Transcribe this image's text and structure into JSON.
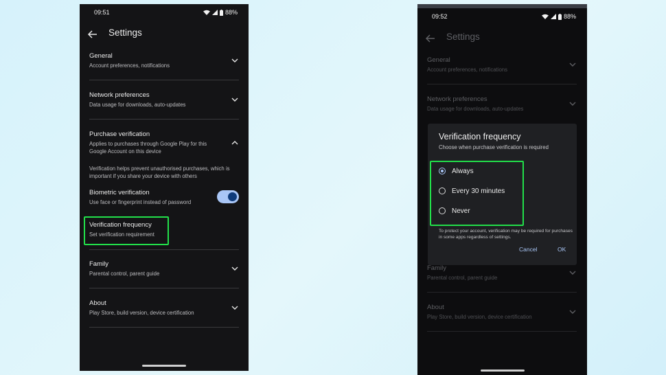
{
  "left": {
    "status": {
      "time": "09:51",
      "battery": "88%"
    },
    "appbar": {
      "title": "Settings"
    },
    "items": [
      {
        "title": "General",
        "subtitle": "Account preferences, notifications"
      },
      {
        "title": "Network preferences",
        "subtitle": "Data usage for downloads, auto-updates"
      },
      {
        "title": "Purchase verification",
        "subtitle": "Applies to purchases through Google Play for this Google Account on this device"
      },
      {
        "title": "Family",
        "subtitle": "Parental control, parent guide"
      },
      {
        "title": "About",
        "subtitle": "Play Store, build version, device certification"
      }
    ],
    "purchase_info": "Verification helps prevent unauthorised purchases, which is important if you share your device with others",
    "biometric": {
      "title": "Biometric verification",
      "subtitle": "Use face or fingerprint instead of password",
      "enabled": true
    },
    "frequency": {
      "title": "Verification frequency",
      "subtitle": "Set verification requirement"
    }
  },
  "right": {
    "status": {
      "time": "09:52",
      "battery": "88%"
    },
    "appbar": {
      "title": "Settings"
    },
    "items": [
      {
        "title": "General",
        "subtitle": "Account preferences, notifications"
      },
      {
        "title": "Network preferences",
        "subtitle": "Data usage for downloads, auto-updates"
      },
      {
        "title": "Family",
        "subtitle": "Parental control, parent guide"
      },
      {
        "title": "About",
        "subtitle": "Play Store, build version, device certification"
      }
    ],
    "dialog": {
      "title": "Verification frequency",
      "subtitle": "Choose when purchase verification is required",
      "options": [
        "Always",
        "Every 30 minutes",
        "Never"
      ],
      "selected": "Always",
      "note": "To protect your account, verification may be required for purchases in some apps regardless of settings.",
      "cancel": "Cancel",
      "ok": "OK"
    }
  },
  "colors": {
    "highlight": "#22e04a",
    "accent": "#a9c6f6",
    "background": "#141416"
  }
}
